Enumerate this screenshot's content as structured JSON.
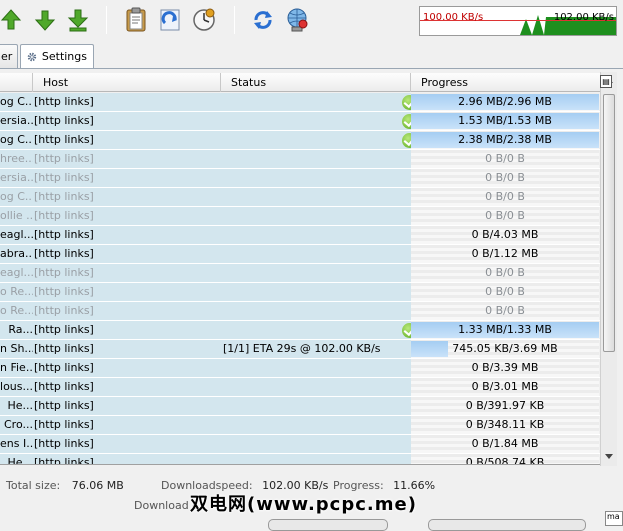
{
  "toolbar": {
    "buttons": [
      "move-up-icon",
      "move-down-icon",
      "move-bottom-icon",
      "clipboard-icon",
      "refresh-grid-icon",
      "clock-icon",
      "reconnect-icon",
      "network-icon"
    ]
  },
  "speed_graph": {
    "limit_label": "100.00 KB/s",
    "current_label": "102.00 KB/s",
    "bar_color": "#1e8f1e",
    "limit_color": "#c00000"
  },
  "tabs": [
    {
      "label": "er"
    },
    {
      "label": "Settings"
    }
  ],
  "table": {
    "columns": [
      "Host",
      "Status",
      "Progress"
    ],
    "rows": [
      {
        "name": "og C...",
        "host": "[http links]",
        "status": "",
        "progress": "2.96 MB/2.96 MB",
        "pct": 1.0,
        "done": true,
        "dim": false
      },
      {
        "name": "ersia...",
        "host": "[http links]",
        "status": "",
        "progress": "1.53 MB/1.53 MB",
        "pct": 1.0,
        "done": true,
        "dim": false
      },
      {
        "name": "og C...",
        "host": "[http links]",
        "status": "",
        "progress": "2.38 MB/2.38 MB",
        "pct": 1.0,
        "done": true,
        "dim": false
      },
      {
        "name": "hree...",
        "host": "[http links]",
        "status": "",
        "progress": "0 B/0 B",
        "pct": 0,
        "done": false,
        "dim": true
      },
      {
        "name": "ersia...",
        "host": "[http links]",
        "status": "",
        "progress": "0 B/0 B",
        "pct": 0,
        "done": false,
        "dim": true
      },
      {
        "name": "og C...",
        "host": "[http links]",
        "status": "",
        "progress": "0 B/0 B",
        "pct": 0,
        "done": false,
        "dim": true
      },
      {
        "name": "ollie ...",
        "host": "[http links]",
        "status": "",
        "progress": "0 B/0 B",
        "pct": 0,
        "done": false,
        "dim": true
      },
      {
        "name": "eagl...",
        "host": "[http links]",
        "status": "",
        "progress": "0 B/4.03 MB",
        "pct": 0,
        "done": false,
        "dim": false
      },
      {
        "name": "abra...",
        "host": "[http links]",
        "status": "",
        "progress": "0 B/1.12 MB",
        "pct": 0,
        "done": false,
        "dim": false
      },
      {
        "name": "eagl...",
        "host": "[http links]",
        "status": "",
        "progress": "0 B/0 B",
        "pct": 0,
        "done": false,
        "dim": true
      },
      {
        "name": "o Re...",
        "host": "[http links]",
        "status": "",
        "progress": "0 B/0 B",
        "pct": 0,
        "done": false,
        "dim": true
      },
      {
        "name": "o Re...",
        "host": "[http links]",
        "status": "",
        "progress": "0 B/0 B",
        "pct": 0,
        "done": false,
        "dim": true
      },
      {
        "name": "Ra...",
        "host": "[http links]",
        "status": "",
        "progress": "1.33 MB/1.33 MB",
        "pct": 1.0,
        "done": true,
        "dim": false
      },
      {
        "name": "n Sh...",
        "host": "[http links]",
        "status": "[1/1] ETA 29s @ 102.00 KB/s",
        "progress": "745.05 KB/3.69 MB",
        "pct": 0.197,
        "done": false,
        "dim": false
      },
      {
        "name": "n Fie...",
        "host": "[http links]",
        "status": "",
        "progress": "0 B/3.39 MB",
        "pct": 0,
        "done": false,
        "dim": false
      },
      {
        "name": "lous...",
        "host": "[http links]",
        "status": "",
        "progress": "0 B/3.01 MB",
        "pct": 0,
        "done": false,
        "dim": false
      },
      {
        "name": "He...",
        "host": "[http links]",
        "status": "",
        "progress": "0 B/391.97 KB",
        "pct": 0,
        "done": false,
        "dim": false
      },
      {
        "name": "Cro...",
        "host": "[http links]",
        "status": "",
        "progress": "0 B/348.11 KB",
        "pct": 0,
        "done": false,
        "dim": false
      },
      {
        "name": "ens I...",
        "host": "[http links]",
        "status": "",
        "progress": "0 B/1.84 MB",
        "pct": 0,
        "done": false,
        "dim": false
      },
      {
        "name": "He...",
        "host": "[http links]",
        "status": "",
        "progress": "0 B/508.74 KB",
        "pct": 0,
        "done": false,
        "dim": false
      }
    ]
  },
  "statusbar": {
    "total_size_label": "Total size:",
    "total_size": "76.06 MB",
    "downloadspeed_label": "Downloadspeed:",
    "downloadspeed": "102.00 KB/s",
    "progress_label": "Progress:",
    "progress": "11.66%",
    "download_label": "Download c"
  },
  "watermark": "双电网(www.pcpc.me)",
  "corner_label": "ma"
}
